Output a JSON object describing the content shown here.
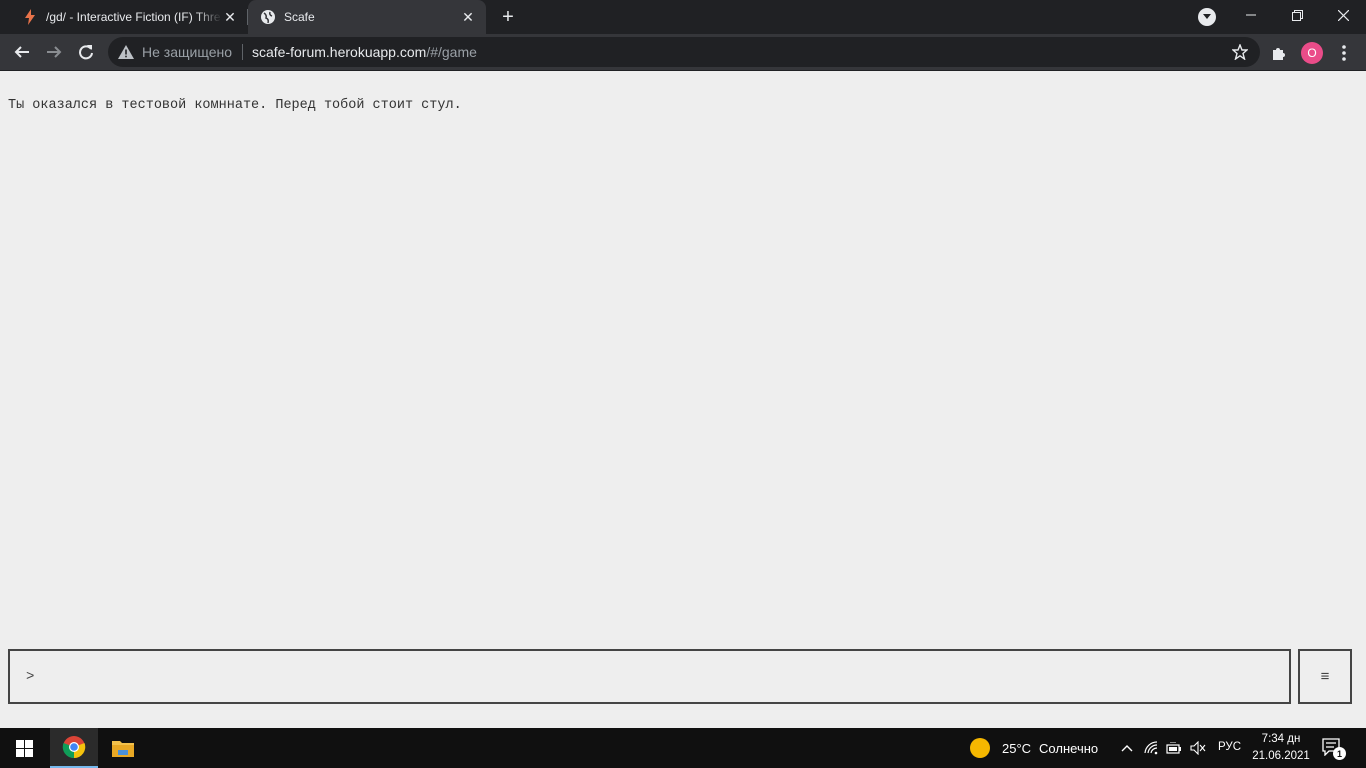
{
  "browser": {
    "tabs": [
      {
        "title": "/gd/ - Interactive Fiction (IF) Thre",
        "favicon": "lightning-icon",
        "active": false
      },
      {
        "title": "Scafe",
        "favicon": "globe-icon",
        "active": true
      }
    ],
    "omnibox": {
      "security_label": "Не защищено",
      "url_host": "scafe-forum.herokuapp.com",
      "url_path": "/#/game"
    },
    "profile_initial": "O",
    "profile_color": "#ea4c89"
  },
  "game": {
    "output_text": "Ты оказался в тестовой комннате. Перед тобой стоит стул.",
    "prompt": ">",
    "input_value": "",
    "menu_icon": "≡"
  },
  "taskbar": {
    "weather_temp": "25°C",
    "weather_text": "Солнечно",
    "language": "РУС",
    "time": "7:34 дн",
    "date": "21.06.2021",
    "notification_count": "1"
  },
  "colors": {
    "page_background": "#eeeeee",
    "border": "#444444",
    "accent_taskbar": "#76b9ed"
  }
}
